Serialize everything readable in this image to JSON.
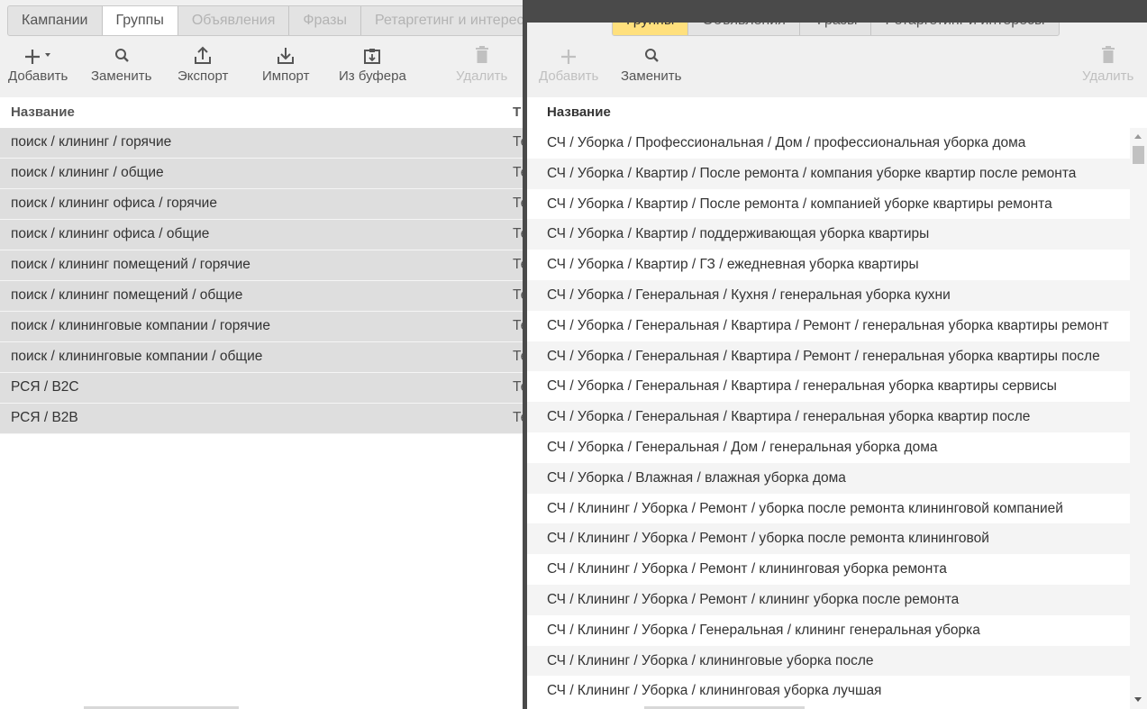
{
  "left": {
    "tabs": [
      {
        "label": "Кампании",
        "state": "normal"
      },
      {
        "label": "Группы",
        "state": "active"
      },
      {
        "label": "Объявления",
        "state": "disabled"
      },
      {
        "label": "Фразы",
        "state": "disabled"
      },
      {
        "label": "Ретаргетинг и интересы",
        "state": "disabled"
      }
    ],
    "toolbar": {
      "add": "Добавить",
      "replace": "Заменить",
      "export": "Экспорт",
      "import": "Импорт",
      "from_buffer": "Из буфера",
      "delete": "Удалить"
    },
    "columns": {
      "name": "Название",
      "second": "Т"
    },
    "rows": [
      {
        "name": "поиск / клининг / горячие",
        "second": "Те"
      },
      {
        "name": "поиск / клининг / общие",
        "second": "Те"
      },
      {
        "name": "поиск / клининг офиса / горячие",
        "second": "Те"
      },
      {
        "name": "поиск / клининг офиса / общие",
        "second": "Те"
      },
      {
        "name": "поиск / клининг помещений / горячие",
        "second": "Те"
      },
      {
        "name": "поиск / клининг помещений / общие",
        "second": "Те"
      },
      {
        "name": "поиск / клининговые компании / горячие",
        "second": "Те"
      },
      {
        "name": "поиск / клининговые компании / общие",
        "second": "Те"
      },
      {
        "name": "РСЯ / B2C",
        "second": "Те"
      },
      {
        "name": "РСЯ / B2B",
        "second": "Те"
      }
    ]
  },
  "right": {
    "tabs": [
      {
        "label": "Группы",
        "state": "active-yellow"
      },
      {
        "label": "Объявления",
        "state": "normal"
      },
      {
        "label": "Фразы",
        "state": "normal"
      },
      {
        "label": "Ретаргетинг и интересы",
        "state": "normal"
      }
    ],
    "toolbar": {
      "add": "Добавить",
      "replace": "Заменить",
      "delete": "Удалить"
    },
    "columns": {
      "name": "Название"
    },
    "rows": [
      "СЧ / Уборка / Профессиональная / Дом / профессиональная уборка дома",
      "СЧ / Уборка / Квартир / После ремонта / компания уборке квартир после ремонта",
      "СЧ / Уборка / Квартир / После ремонта / компанией уборке квартиры ремонта",
      "СЧ / Уборка / Квартир / поддерживающая уборка квартиры",
      "СЧ / Уборка / Квартир / ГЗ / ежедневная уборка квартиры",
      "СЧ / Уборка / Генеральная / Кухня / генеральная уборка кухни",
      "СЧ / Уборка / Генеральная / Квартира / Ремонт / генеральная уборка квартиры ремонт",
      "СЧ / Уборка / Генеральная / Квартира / Ремонт / генеральная уборка квартиры после",
      "СЧ / Уборка / Генеральная / Квартира / генеральная уборка квартиры сервисы",
      "СЧ / Уборка / Генеральная / Квартира / генеральная уборка квартир после",
      "СЧ / Уборка / Генеральная / Дом / генеральная уборка дома",
      "СЧ / Уборка / Влажная / влажная уборка дома",
      "СЧ / Клининг / Уборка / Ремонт / уборка после ремонта клининговой компанией",
      "СЧ / Клининг / Уборка / Ремонт / уборка после ремонта клининговой",
      "СЧ / Клининг / Уборка / Ремонт / клининговая уборка ремонта",
      "СЧ / Клининг / Уборка / Ремонт / клининг уборка после ремонта",
      "СЧ / Клининг / Уборка / Генеральная / клининг генеральная уборка",
      "СЧ / Клининг / Уборка / клининговые уборка после",
      "СЧ / Клининг / Уборка / клининговая уборка лучшая"
    ]
  },
  "icons": {
    "add": "plus-icon",
    "add_dropdown": "caret-down-icon",
    "replace": "search-icon",
    "export": "upload-icon",
    "import": "download-icon",
    "from_buffer": "clipboard-icon",
    "delete": "trash-icon"
  },
  "colors": {
    "active_tab_yellow": "#ffe07d",
    "selected_row_gray": "#dedede",
    "divider": "#4a4a4a"
  }
}
